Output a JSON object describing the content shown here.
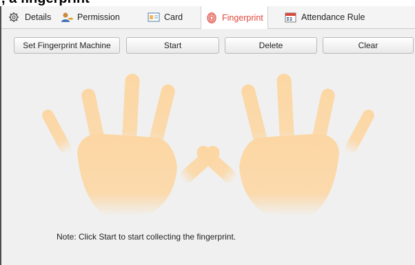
{
  "tabs": {
    "details": "Details",
    "permission": "Permission",
    "card": "Card",
    "fingerprint": "Fingerprint",
    "attendance_rule": "Attendance Rule",
    "active": "fingerprint"
  },
  "icons": {
    "details": "gear-icon",
    "permission": "person-key-icon",
    "card": "id-card-icon",
    "fingerprint": "fingerprint-icon",
    "attendance_rule": "calendar-icon",
    "hands": "hand-outline-icon"
  },
  "toolbar": {
    "set_machine": "Set Fingerprint Machine",
    "start": "Start",
    "delete": "Delete",
    "clear": "Clear"
  },
  "note": "Note: Click Start to start collecting the fingerprint.",
  "colors": {
    "active_tab_text": "#e0483d",
    "hand_fill": "#fcd7a4",
    "panel_bg": "#f0f0f0"
  }
}
